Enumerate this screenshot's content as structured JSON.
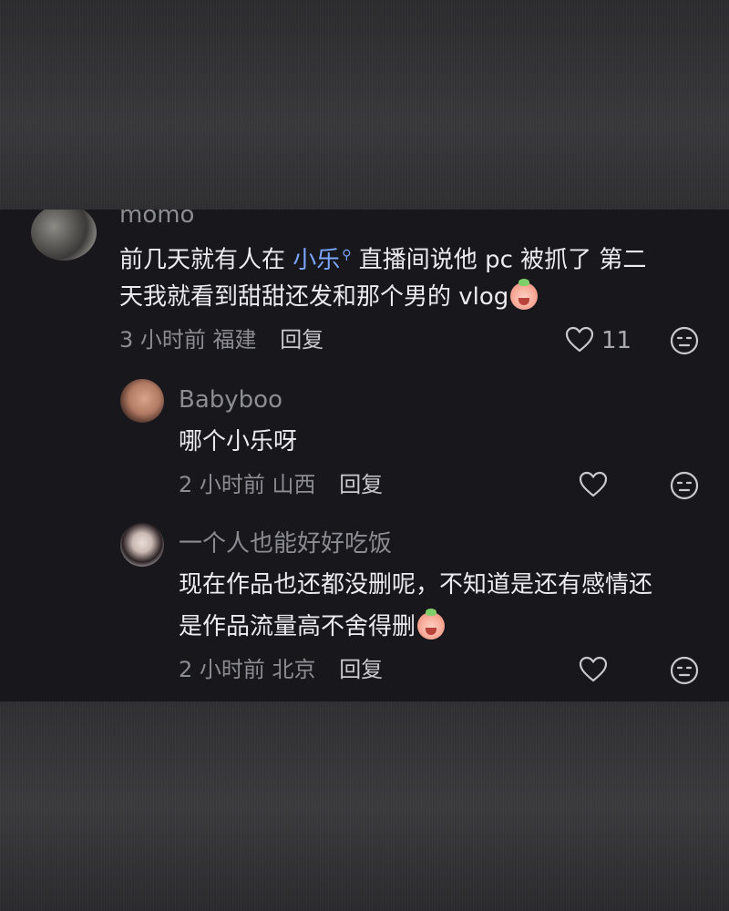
{
  "comments": [
    {
      "username": "momo",
      "text_line1_before": "前几天就有人在 ",
      "text_link": "小乐",
      "text_line1_after": " 直播间说他 pc 被抓了 第二",
      "text_line2": "天我就看到甜甜还发和那个男的 vlog",
      "time": "3 小时前",
      "location": "福建",
      "reply": "回复",
      "likes": "11"
    },
    {
      "username": "Babyboo",
      "text_line1": "哪个小乐呀",
      "time": "2 小时前",
      "location": "山西",
      "reply": "回复"
    },
    {
      "username": "一个人也能好好吃饭",
      "text_line1": "现在作品也还都没删呢，不知道是还有感情还",
      "text_line2": "是作品流量高不舍得删",
      "time": "2 小时前",
      "location": "北京",
      "reply": "回复"
    }
  ],
  "icons": {
    "like": "heart-outline-icon",
    "dislike": "meh-face-icon",
    "emoji": "crying-face-emoji",
    "search": "search-icon"
  },
  "colors": {
    "panel_bg": "#17171c",
    "link": "#7aa6ff",
    "muted": "#8c8c93"
  }
}
